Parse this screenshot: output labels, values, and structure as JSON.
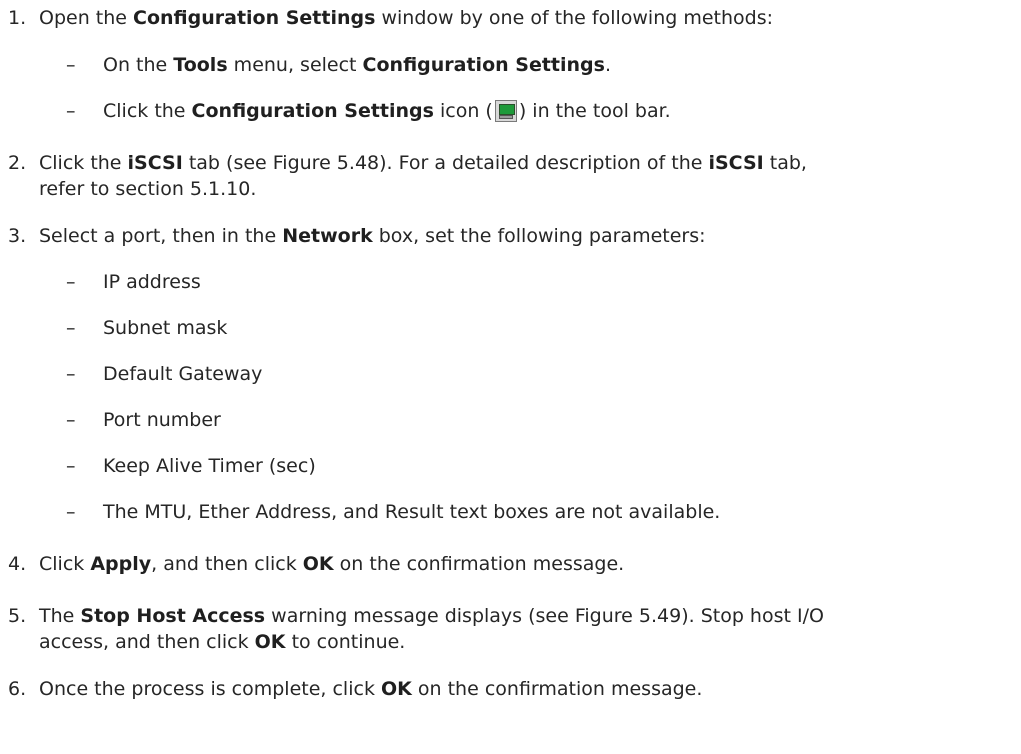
{
  "steps": [
    {
      "number": "1.",
      "parts": [
        "Open the ",
        "Configuration Settings",
        " window by one of the following methods:"
      ],
      "sub": [
        {
          "parts": [
            "On the ",
            "Tools",
            " menu, select ",
            "Configuration Settings",
            "."
          ]
        },
        {
          "parts": [
            "Click the ",
            "Configuration Settings",
            " icon (",
            ") in the tool bar."
          ]
        }
      ]
    },
    {
      "number": "2.",
      "line1": [
        "Click the ",
        "iSCSI",
        " tab (see Figure 5.48). For a detailed description of the ",
        "iSCSI",
        " tab,"
      ],
      "line2": "refer to section 5.1.10."
    },
    {
      "number": "3.",
      "parts": [
        "Select a port, then in the ",
        "Network",
        " box, set the following parameters:"
      ],
      "sub": [
        "IP address",
        "Subnet mask",
        "Default Gateway",
        "Port number",
        "Keep Alive Timer (sec)",
        "The MTU, Ether Address, and Result text boxes are not available."
      ]
    },
    {
      "number": "4.",
      "parts": [
        "Click ",
        "Apply",
        ", and then click ",
        "OK",
        " on the confirmation message."
      ]
    },
    {
      "number": "5.",
      "line1": [
        "The ",
        "Stop Host Access",
        " warning message displays (see Figure 5.49). Stop host I/O"
      ],
      "line2": [
        "access, and then click ",
        "OK",
        " to continue."
      ]
    },
    {
      "number": "6.",
      "parts": [
        "Once the process is complete, click ",
        "OK",
        " on the confirmation message."
      ]
    }
  ],
  "dash_char": "–",
  "icons": {
    "config_settings": "configuration-settings-icon"
  }
}
